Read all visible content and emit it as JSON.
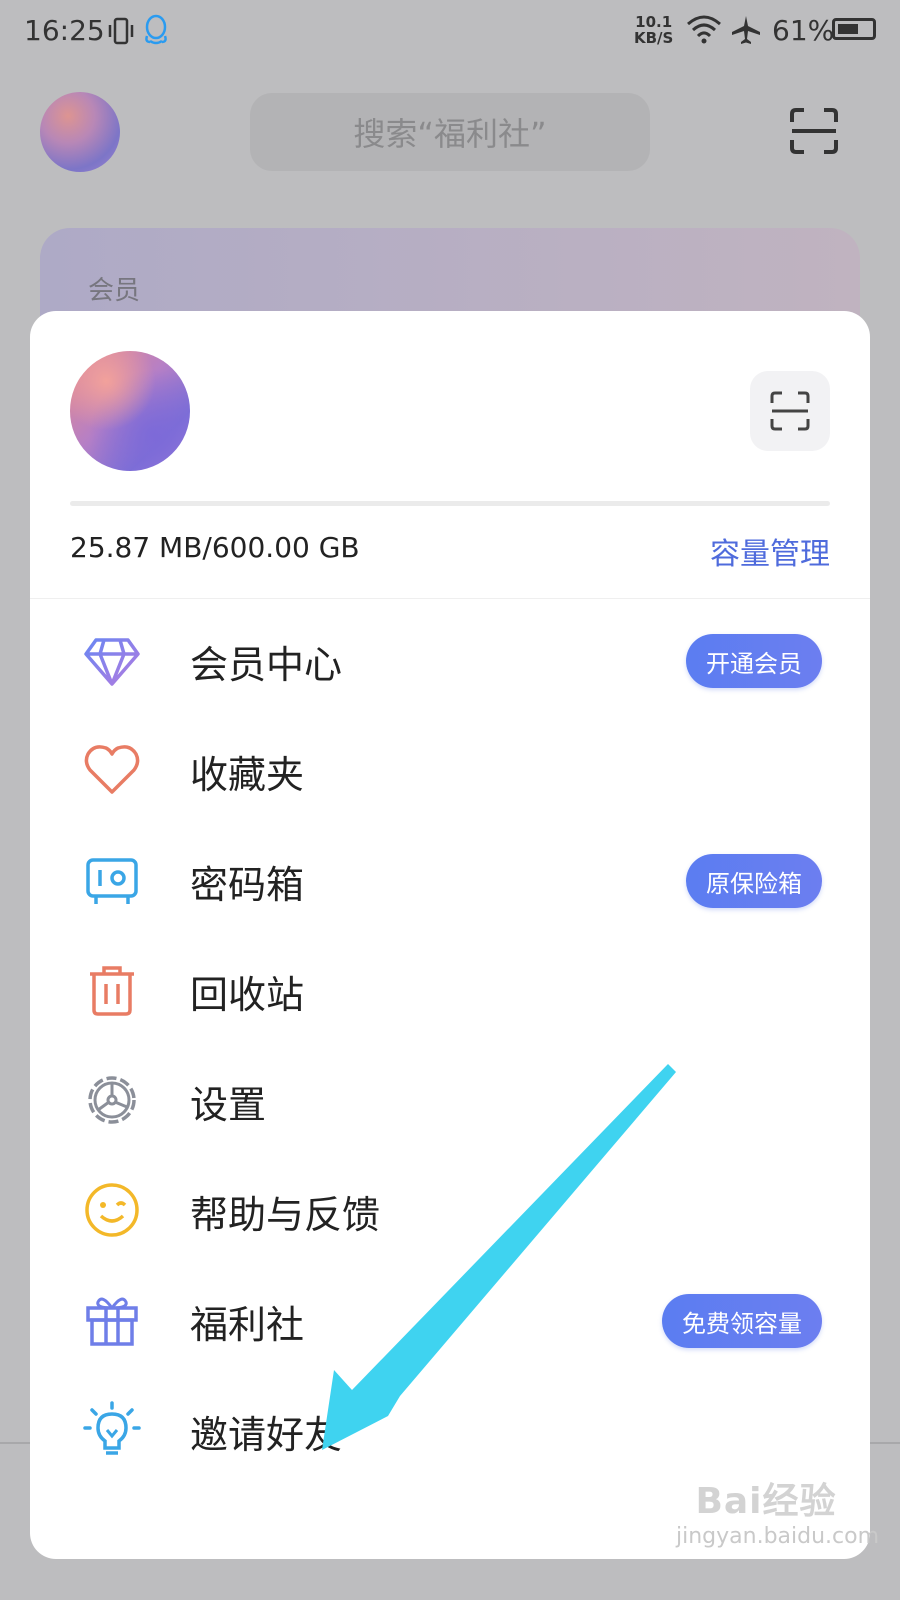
{
  "status_bar": {
    "time": "16:25",
    "net_speed_value": "10.1",
    "net_speed_unit": "KB/S",
    "battery_text": "61%",
    "battery_level": 0.61
  },
  "background": {
    "search_placeholder": "搜索“福利社”",
    "member_card_label": "会员"
  },
  "panel": {
    "storage_text": "25.87 MB/600.00 GB",
    "storage_used_fraction": 0.0,
    "manage_label": "容量管理",
    "menu": [
      {
        "label": "会员中心",
        "icon": "diamond-icon",
        "badge": "开通会员"
      },
      {
        "label": "收藏夹",
        "icon": "heart-icon",
        "badge": ""
      },
      {
        "label": "密码箱",
        "icon": "safe-icon",
        "badge": "原保险箱"
      },
      {
        "label": "回收站",
        "icon": "trash-icon",
        "badge": ""
      },
      {
        "label": "设置",
        "icon": "gear-icon",
        "badge": ""
      },
      {
        "label": "帮助与反馈",
        "icon": "wink-face-icon",
        "badge": ""
      },
      {
        "label": "福利社",
        "icon": "gift-icon",
        "badge": "免费领容量"
      },
      {
        "label": "邀请好友",
        "icon": "lightbulb-icon",
        "badge": ""
      }
    ]
  },
  "watermark": {
    "brand": "Bai经验",
    "url": "jingyan.baidu.com"
  },
  "colors": {
    "accent": "#4f6bdc",
    "badge": "#5b7df1",
    "arrow": "#3fd3f0"
  }
}
